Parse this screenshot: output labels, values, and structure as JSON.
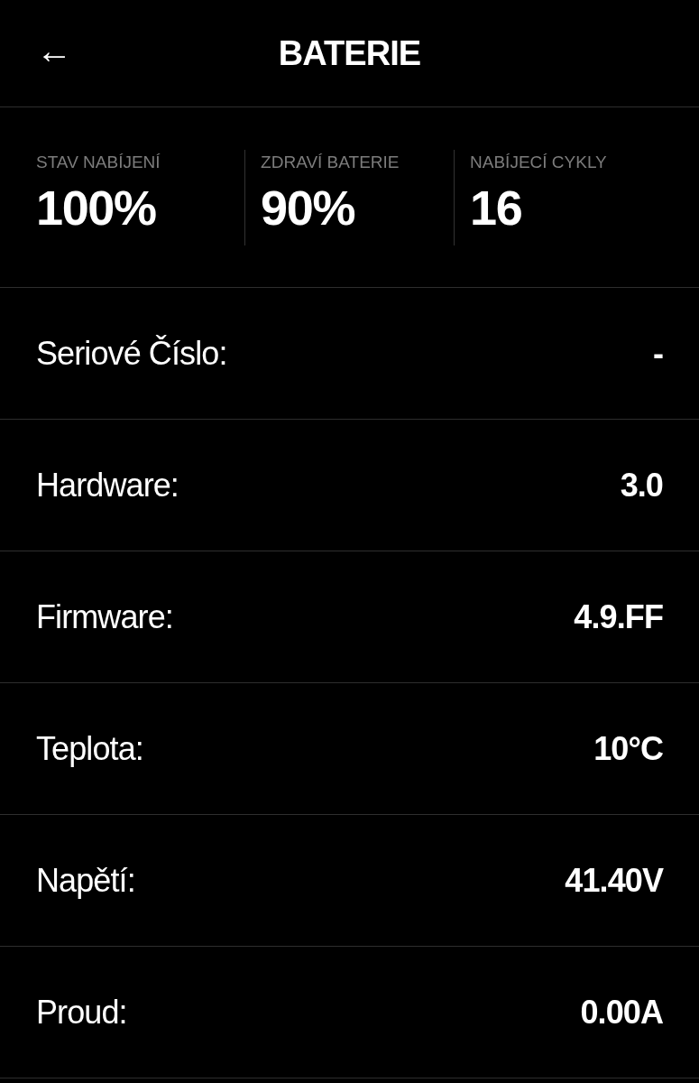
{
  "header": {
    "back_icon": "←",
    "title": "BATERIE"
  },
  "stats": [
    {
      "label": "STAV NABÍJENÍ",
      "value": "100%"
    },
    {
      "label": "ZDRAVÍ BATERIE",
      "value": "90%"
    },
    {
      "label": "NABÍJECÍ CYKLY",
      "value": "16"
    }
  ],
  "rows": [
    {
      "label": "Seriové Číslo:",
      "value": "-"
    },
    {
      "label": "Hardware:",
      "value": "3.0"
    },
    {
      "label": "Firmware:",
      "value": "4.9.FF"
    },
    {
      "label": "Teplota:",
      "value": "10°C"
    },
    {
      "label": "Napětí:",
      "value": "41.40V"
    },
    {
      "label": "Proud:",
      "value": "0.00A"
    }
  ]
}
